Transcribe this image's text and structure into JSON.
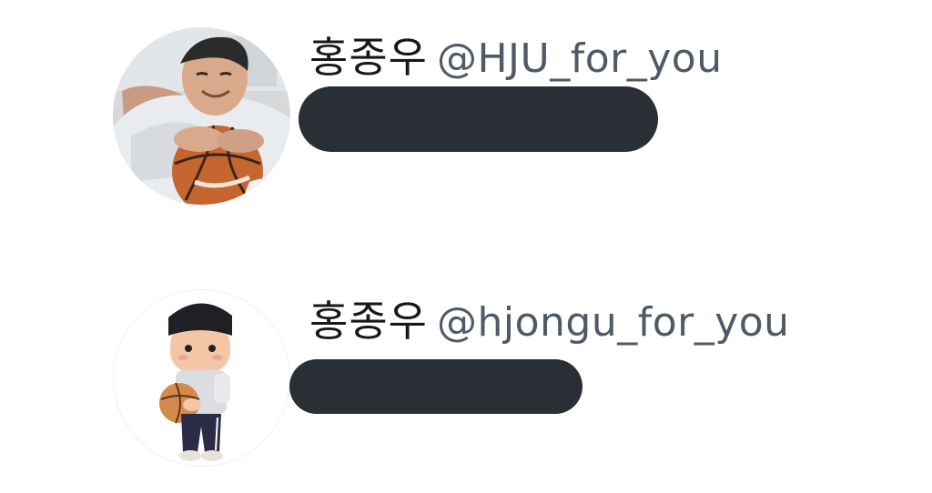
{
  "accounts": [
    {
      "display_name": "홍종우",
      "handle": "@HJU_for_you",
      "avatar_icon": "profile-photo-man-with-basketball",
      "bio_redacted": true
    },
    {
      "display_name": "홍종우",
      "handle": "@hjongu_for_you",
      "avatar_icon": "cartoon-boy-with-basketball",
      "bio_redacted": true
    }
  ],
  "colors": {
    "name_text": "#16181b",
    "handle_text": "#4f5a66",
    "redaction_bar": "#2a2f36",
    "background": "#ffffff"
  }
}
